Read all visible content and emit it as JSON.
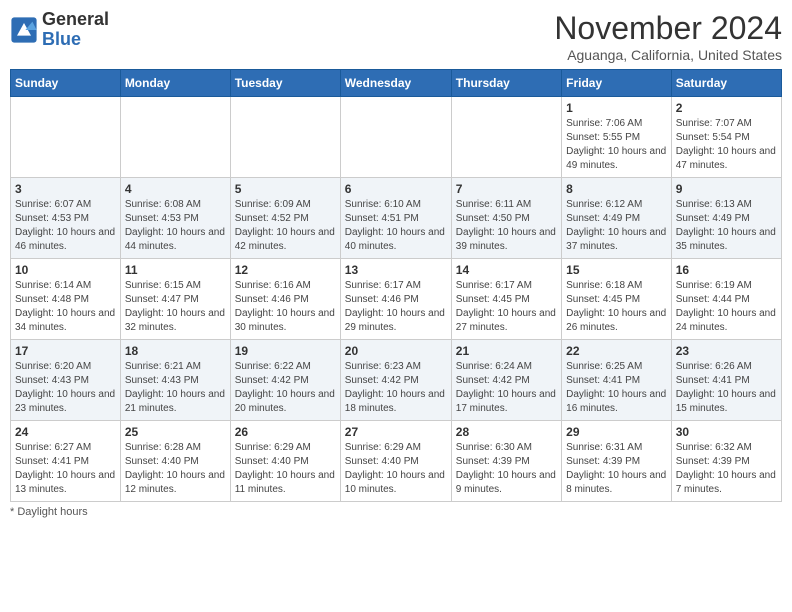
{
  "header": {
    "logo_line1": "General",
    "logo_line2": "Blue",
    "month_title": "November 2024",
    "location": "Aguanga, California, United States"
  },
  "weekdays": [
    "Sunday",
    "Monday",
    "Tuesday",
    "Wednesday",
    "Thursday",
    "Friday",
    "Saturday"
  ],
  "weeks": [
    [
      {
        "day": "",
        "info": ""
      },
      {
        "day": "",
        "info": ""
      },
      {
        "day": "",
        "info": ""
      },
      {
        "day": "",
        "info": ""
      },
      {
        "day": "",
        "info": ""
      },
      {
        "day": "1",
        "info": "Sunrise: 7:06 AM\nSunset: 5:55 PM\nDaylight: 10 hours and 49 minutes."
      },
      {
        "day": "2",
        "info": "Sunrise: 7:07 AM\nSunset: 5:54 PM\nDaylight: 10 hours and 47 minutes."
      }
    ],
    [
      {
        "day": "3",
        "info": "Sunrise: 6:07 AM\nSunset: 4:53 PM\nDaylight: 10 hours and 46 minutes."
      },
      {
        "day": "4",
        "info": "Sunrise: 6:08 AM\nSunset: 4:53 PM\nDaylight: 10 hours and 44 minutes."
      },
      {
        "day": "5",
        "info": "Sunrise: 6:09 AM\nSunset: 4:52 PM\nDaylight: 10 hours and 42 minutes."
      },
      {
        "day": "6",
        "info": "Sunrise: 6:10 AM\nSunset: 4:51 PM\nDaylight: 10 hours and 40 minutes."
      },
      {
        "day": "7",
        "info": "Sunrise: 6:11 AM\nSunset: 4:50 PM\nDaylight: 10 hours and 39 minutes."
      },
      {
        "day": "8",
        "info": "Sunrise: 6:12 AM\nSunset: 4:49 PM\nDaylight: 10 hours and 37 minutes."
      },
      {
        "day": "9",
        "info": "Sunrise: 6:13 AM\nSunset: 4:49 PM\nDaylight: 10 hours and 35 minutes."
      }
    ],
    [
      {
        "day": "10",
        "info": "Sunrise: 6:14 AM\nSunset: 4:48 PM\nDaylight: 10 hours and 34 minutes."
      },
      {
        "day": "11",
        "info": "Sunrise: 6:15 AM\nSunset: 4:47 PM\nDaylight: 10 hours and 32 minutes."
      },
      {
        "day": "12",
        "info": "Sunrise: 6:16 AM\nSunset: 4:46 PM\nDaylight: 10 hours and 30 minutes."
      },
      {
        "day": "13",
        "info": "Sunrise: 6:17 AM\nSunset: 4:46 PM\nDaylight: 10 hours and 29 minutes."
      },
      {
        "day": "14",
        "info": "Sunrise: 6:17 AM\nSunset: 4:45 PM\nDaylight: 10 hours and 27 minutes."
      },
      {
        "day": "15",
        "info": "Sunrise: 6:18 AM\nSunset: 4:45 PM\nDaylight: 10 hours and 26 minutes."
      },
      {
        "day": "16",
        "info": "Sunrise: 6:19 AM\nSunset: 4:44 PM\nDaylight: 10 hours and 24 minutes."
      }
    ],
    [
      {
        "day": "17",
        "info": "Sunrise: 6:20 AM\nSunset: 4:43 PM\nDaylight: 10 hours and 23 minutes."
      },
      {
        "day": "18",
        "info": "Sunrise: 6:21 AM\nSunset: 4:43 PM\nDaylight: 10 hours and 21 minutes."
      },
      {
        "day": "19",
        "info": "Sunrise: 6:22 AM\nSunset: 4:42 PM\nDaylight: 10 hours and 20 minutes."
      },
      {
        "day": "20",
        "info": "Sunrise: 6:23 AM\nSunset: 4:42 PM\nDaylight: 10 hours and 18 minutes."
      },
      {
        "day": "21",
        "info": "Sunrise: 6:24 AM\nSunset: 4:42 PM\nDaylight: 10 hours and 17 minutes."
      },
      {
        "day": "22",
        "info": "Sunrise: 6:25 AM\nSunset: 4:41 PM\nDaylight: 10 hours and 16 minutes."
      },
      {
        "day": "23",
        "info": "Sunrise: 6:26 AM\nSunset: 4:41 PM\nDaylight: 10 hours and 15 minutes."
      }
    ],
    [
      {
        "day": "24",
        "info": "Sunrise: 6:27 AM\nSunset: 4:41 PM\nDaylight: 10 hours and 13 minutes."
      },
      {
        "day": "25",
        "info": "Sunrise: 6:28 AM\nSunset: 4:40 PM\nDaylight: 10 hours and 12 minutes."
      },
      {
        "day": "26",
        "info": "Sunrise: 6:29 AM\nSunset: 4:40 PM\nDaylight: 10 hours and 11 minutes."
      },
      {
        "day": "27",
        "info": "Sunrise: 6:29 AM\nSunset: 4:40 PM\nDaylight: 10 hours and 10 minutes."
      },
      {
        "day": "28",
        "info": "Sunrise: 6:30 AM\nSunset: 4:39 PM\nDaylight: 10 hours and 9 minutes."
      },
      {
        "day": "29",
        "info": "Sunrise: 6:31 AM\nSunset: 4:39 PM\nDaylight: 10 hours and 8 minutes."
      },
      {
        "day": "30",
        "info": "Sunrise: 6:32 AM\nSunset: 4:39 PM\nDaylight: 10 hours and 7 minutes."
      }
    ]
  ],
  "footer": {
    "note": "Daylight hours"
  }
}
